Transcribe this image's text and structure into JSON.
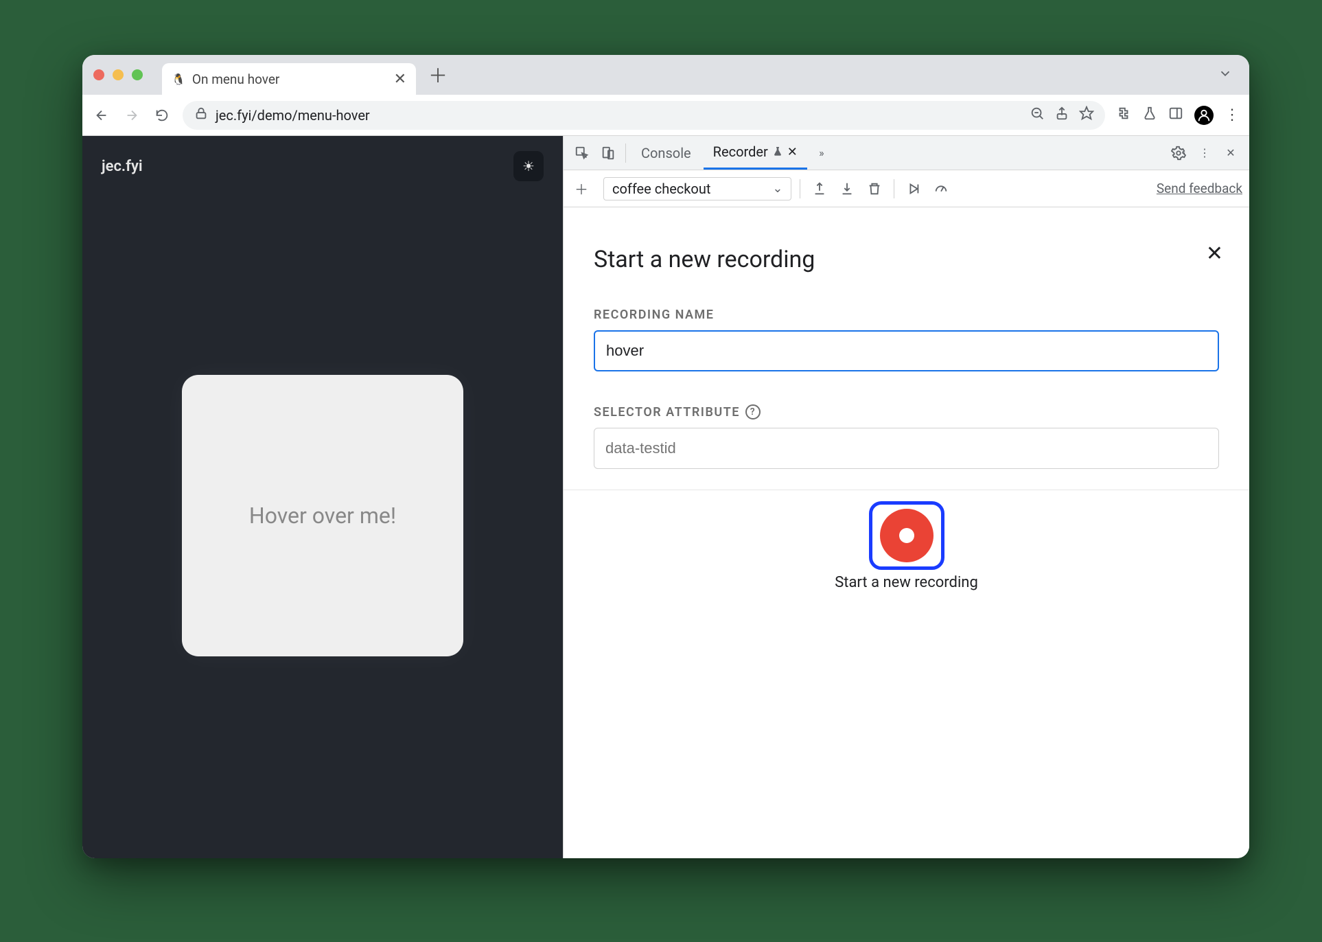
{
  "browser": {
    "tab_title": "On menu hover",
    "url": "jec.fyi/demo/menu-hover"
  },
  "page": {
    "site_name": "jec.fyi",
    "card_text": "Hover over me!"
  },
  "devtools": {
    "tabs": {
      "console": "Console",
      "recorder": "Recorder"
    },
    "recorder_toolbar": {
      "selected_recording": "coffee checkout",
      "feedback": "Send feedback"
    },
    "recorder_form": {
      "heading": "Start a new recording",
      "name_label": "RECORDING NAME",
      "name_value": "hover",
      "selector_label": "SELECTOR ATTRIBUTE",
      "selector_placeholder": "data-testid",
      "start_label": "Start a new recording"
    }
  }
}
